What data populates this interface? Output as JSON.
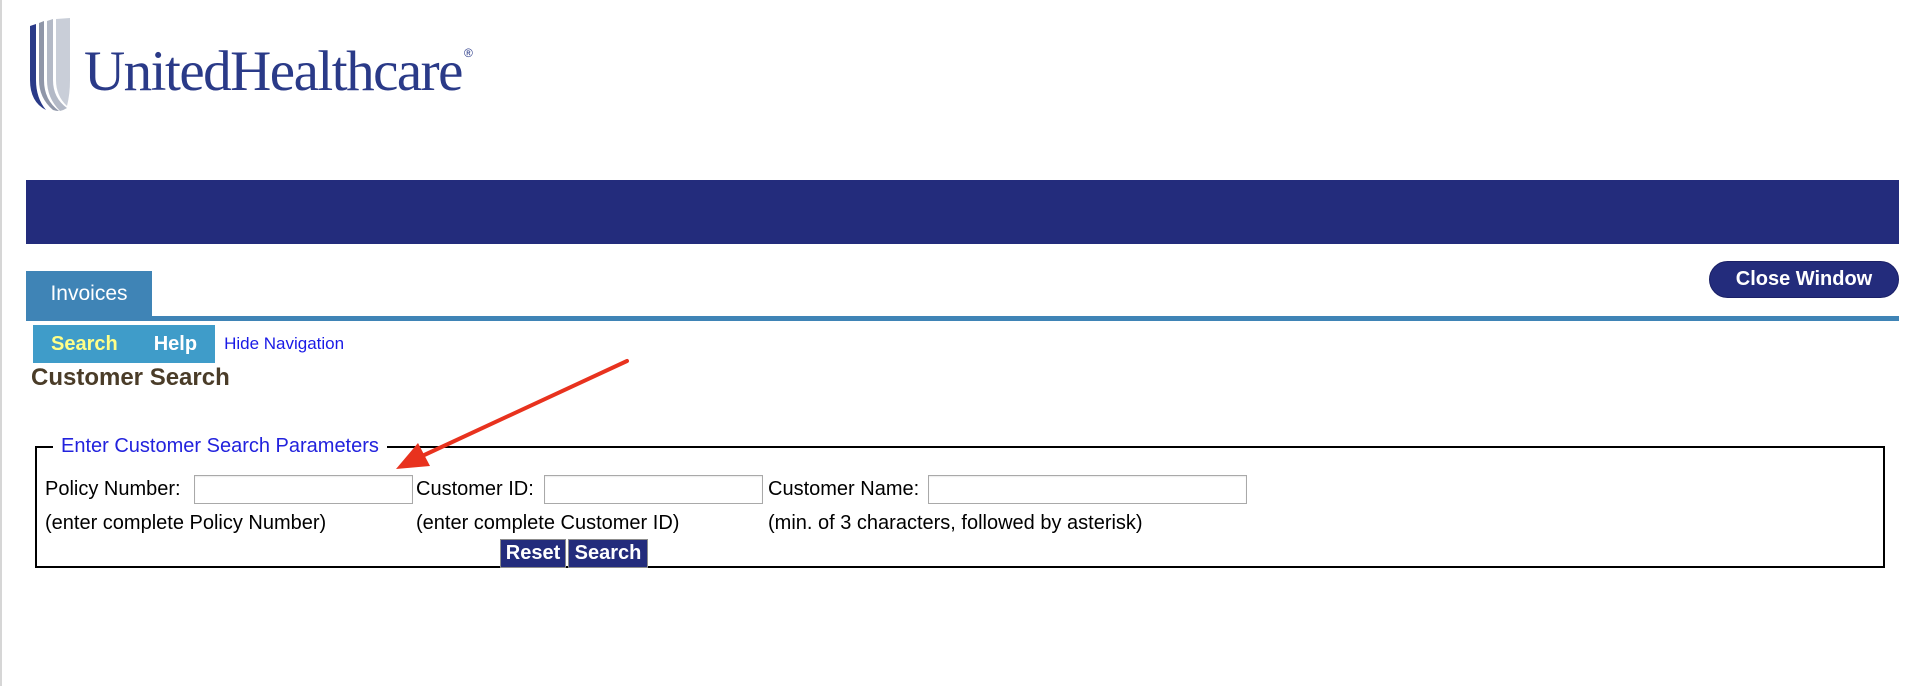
{
  "brand": {
    "name": "UnitedHealthcare",
    "registered_mark": "®",
    "logo_color": "#2a3a88"
  },
  "colors": {
    "banner": "#232c7c",
    "tab": "#3f84b6",
    "subnav": "#3f9cc9",
    "subnav_active_text": "#ffff88",
    "link": "#1a1ae6",
    "legend": "#2222dd",
    "annotation_arrow": "#e8321e"
  },
  "tabs": [
    {
      "label": "Invoices",
      "active": true
    }
  ],
  "header": {
    "close_window_label": "Close Window"
  },
  "subnav": {
    "items": [
      {
        "label": "Search",
        "active": true
      },
      {
        "label": "Help",
        "active": false
      }
    ],
    "hide_navigation_label": "Hide Navigation"
  },
  "page": {
    "title": "Customer Search"
  },
  "search_form": {
    "legend": "Enter Customer Search Parameters",
    "policy_number": {
      "label": "Policy Number:",
      "hint": "(enter complete Policy Number)",
      "value": ""
    },
    "customer_id": {
      "label": "Customer ID:",
      "hint": "(enter complete Customer ID)",
      "value": ""
    },
    "customer_name": {
      "label": "Customer Name:",
      "hint": "(min. of 3 characters, followed by asterisk)",
      "value": ""
    },
    "reset_label": "Reset",
    "search_label": "Search"
  },
  "icons": {
    "logo_mark": "uhc-shield-logo-icon",
    "annotation": "red-arrow-icon"
  }
}
